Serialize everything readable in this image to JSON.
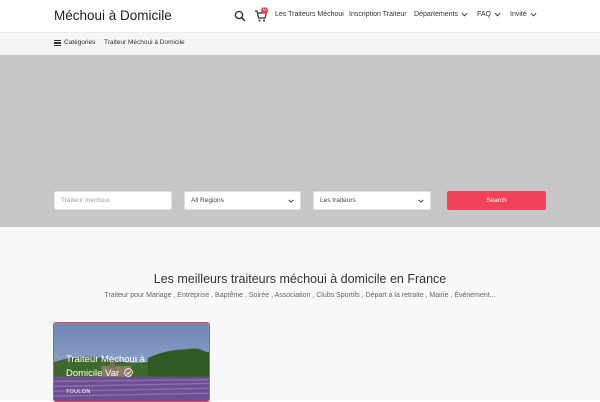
{
  "header": {
    "logo": "Méchoui à Domicile",
    "search_icon": "search-icon",
    "cart_icon": "cart-icon",
    "cart_count": "0",
    "nav": [
      {
        "label": "Les Traiteurs Méchoui",
        "dropdown": false
      },
      {
        "label": "Inscription Traiteur",
        "dropdown": false
      },
      {
        "label": "Départements",
        "dropdown": true
      },
      {
        "label": "FAQ",
        "dropdown": true
      },
      {
        "label": "Invité",
        "dropdown": true
      }
    ]
  },
  "category_bar": {
    "menu_icon": "hamburger-icon",
    "categories_label": "Catégories",
    "breadcrumb": "Traiteur Méchoui à Domicile"
  },
  "search": {
    "keyword_placeholder": "Traiteur mechoui",
    "region_value": "All Regions",
    "type_value": "Les traiteurs",
    "button_label": "Search"
  },
  "main": {
    "heading": "Les meilleurs traiteurs méchoui à domicile en France",
    "subheading": "Traiteur pour Mariage , Entreprise , Baptême , Soirée , Association , Clubs Sportifs , Départ à la retraite , Mairie , Événement..."
  },
  "listing_card": {
    "title": "Traiteur Méchoui à Domicile Var",
    "verified_icon": "check-circle-icon",
    "location": "TOULON"
  },
  "colors": {
    "accent": "#f2415a",
    "hero_bg": "#c6c6c6",
    "content_bg": "#f8f8f8"
  }
}
